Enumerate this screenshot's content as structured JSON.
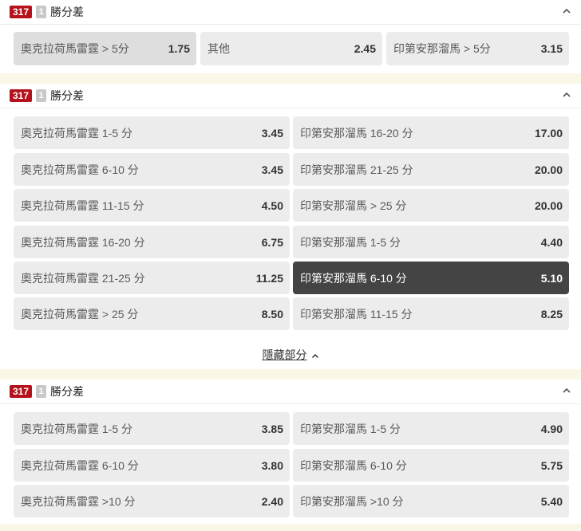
{
  "sections": [
    {
      "id": "317",
      "count": "1",
      "title": "勝分差",
      "odds": [
        {
          "label": "奧克拉荷馬雷霆 > 5分",
          "value": "1.75"
        },
        {
          "label": "其他",
          "value": "2.45"
        },
        {
          "label": "印第安那溜馬 > 5分",
          "value": "3.15"
        }
      ]
    },
    {
      "id": "317",
      "count": "1",
      "title": "勝分差",
      "odds_left": [
        {
          "label": "奧克拉荷馬雷霆 1-5 分",
          "value": "3.45"
        },
        {
          "label": "奧克拉荷馬雷霆 6-10 分",
          "value": "3.45"
        },
        {
          "label": "奧克拉荷馬雷霆 11-15 分",
          "value": "4.50"
        },
        {
          "label": "奧克拉荷馬雷霆 16-20 分",
          "value": "6.75"
        },
        {
          "label": "奧克拉荷馬雷霆 21-25 分",
          "value": "11.25"
        },
        {
          "label": "奧克拉荷馬雷霆 > 25 分",
          "value": "8.50"
        }
      ],
      "odds_right": [
        {
          "label": "印第安那溜馬 16-20 分",
          "value": "17.00"
        },
        {
          "label": "印第安那溜馬 21-25 分",
          "value": "20.00"
        },
        {
          "label": "印第安那溜馬 > 25 分",
          "value": "20.00"
        },
        {
          "label": "印第安那溜馬 1-5 分",
          "value": "4.40"
        },
        {
          "label": "印第安那溜馬 6-10 分",
          "value": "5.10"
        },
        {
          "label": "印第安那溜馬 11-15 分",
          "value": "8.25"
        }
      ],
      "selected": "印第安那溜馬 6-10 分",
      "toggle_label": "隱藏部分"
    },
    {
      "id": "317",
      "count": "1",
      "title": "勝分差",
      "odds_left": [
        {
          "label": "奧克拉荷馬雷霆 1-5 分",
          "value": "3.85"
        },
        {
          "label": "奧克拉荷馬雷霆 6-10 分",
          "value": "3.80"
        },
        {
          "label": "奧克拉荷馬雷霆 >10 分",
          "value": "2.40"
        }
      ],
      "odds_right": [
        {
          "label": "印第安那溜馬 1-5 分",
          "value": "4.90"
        },
        {
          "label": "印第安那溜馬 6-10 分",
          "value": "5.75"
        },
        {
          "label": "印第安那溜馬 >10 分",
          "value": "5.40"
        }
      ]
    }
  ],
  "icons": {
    "collapse": "chevron-up-icon",
    "toggle": "chevron-up-icon"
  },
  "colors": {
    "id_badge": "#b5121b",
    "selected_bg": "#444444",
    "odd_bg": "#ececec",
    "page_bg": "#fbf7e6"
  }
}
